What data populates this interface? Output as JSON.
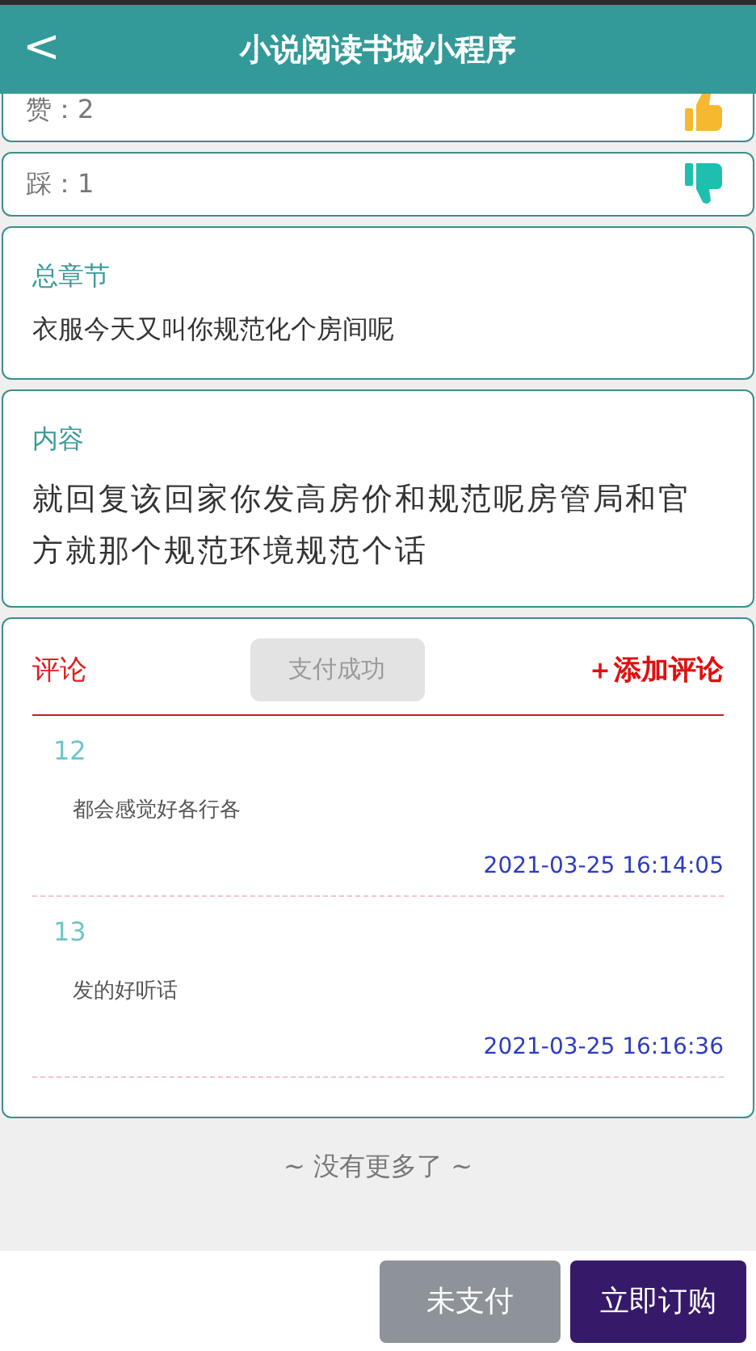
{
  "header": {
    "back_icon": "<",
    "title": "小说阅读书城小程序"
  },
  "votes": [
    {
      "kind": "like",
      "label": "赞：2"
    },
    {
      "kind": "dislike",
      "label": "踩：1"
    }
  ],
  "chapter": {
    "label": "总章节",
    "value": "衣服今天又叫你规范化个房间呢"
  },
  "content": {
    "label": "内容",
    "value": "就回复该回家你发高房价和规范呢房管局和官方就那个规范环境规范个话"
  },
  "comments": {
    "title": "评论",
    "payment_badge": "支付成功",
    "add_button": "＋添加评论",
    "items": [
      {
        "user": "12",
        "text": "都会感觉好各行各",
        "time": "2021-03-25 16:14:05"
      },
      {
        "user": "13",
        "text": "发的好听话",
        "time": "2021-03-25 16:16:36"
      }
    ]
  },
  "end_note": "~ 没有更多了 ~",
  "actions": [
    {
      "kind": "secondary",
      "label": "未支付"
    },
    {
      "kind": "primary",
      "label": "立即订购"
    }
  ]
}
